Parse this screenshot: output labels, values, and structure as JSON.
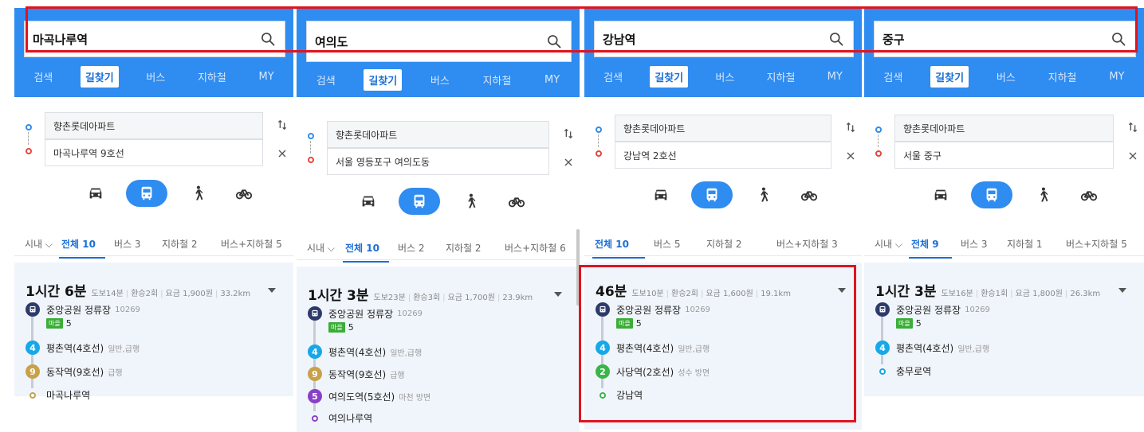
{
  "panels": [
    {
      "search": "마곡나루역",
      "nav": [
        "검색",
        "길찾기",
        "버스",
        "지하철",
        "MY"
      ],
      "active_nav": 1,
      "origin": "향촌롯데아파트",
      "destination": "마곡나루역 9호선",
      "tabs": [
        "시내 ⌵",
        "전체 10",
        "버스 3",
        "지하철 2",
        "버스+지하철 5"
      ],
      "active_tab": 1,
      "result": {
        "time": "1시간 6분",
        "walk": "도보14분",
        "transfer": "환승2회",
        "fare": "요금 1,900원",
        "distance": "33.2km",
        "steps": [
          {
            "badge": "bus",
            "color": "#2d3b6b",
            "name": "중앙공원 정류장",
            "sub": "10269"
          },
          {
            "badge": "4",
            "color": "#18a8e8",
            "name": "평촌역(4호선)",
            "sub": "일반,급행"
          },
          {
            "badge": "9",
            "color": "#c8a14a",
            "name": "동작역(9호선)",
            "sub": "급행"
          },
          {
            "badge": "end",
            "color": "#c8a14a",
            "name": "마곡나루역",
            "sub": ""
          }
        ],
        "bus_tag": "마을",
        "bus_no": "5"
      }
    },
    {
      "search": "여의도",
      "nav": [
        "검색",
        "길찾기",
        "버스",
        "지하철",
        "MY"
      ],
      "active_nav": 1,
      "origin": "향촌롯데아파트",
      "destination": "서울 영등포구 여의도동",
      "tabs": [
        "시내 ⌵",
        "전체 10",
        "버스 2",
        "지하철 2",
        "버스+지하철 6"
      ],
      "active_tab": 1,
      "result": {
        "time": "1시간 3분",
        "walk": "도보23분",
        "transfer": "환승3회",
        "fare": "요금 1,700원",
        "distance": "23.9km",
        "steps": [
          {
            "badge": "bus",
            "color": "#2d3b6b",
            "name": "중앙공원 정류장",
            "sub": "10269"
          },
          {
            "badge": "4",
            "color": "#18a8e8",
            "name": "평촌역(4호선)",
            "sub": "일반,급행"
          },
          {
            "badge": "9",
            "color": "#c8a14a",
            "name": "동작역(9호선)",
            "sub": "급행"
          },
          {
            "badge": "5",
            "color": "#8a3fc8",
            "name": "여의도역(5호선)",
            "sub": "마천 방면"
          },
          {
            "badge": "end",
            "color": "#8a3fc8",
            "name": "여의나루역",
            "sub": ""
          }
        ],
        "bus_tag": "마을",
        "bus_no": "5"
      }
    },
    {
      "search": "강남역",
      "nav": [
        "검색",
        "길찾기",
        "버스",
        "지하철",
        "MY"
      ],
      "active_nav": 1,
      "origin": "향촌롯데아파트",
      "destination": "강남역 2호선",
      "tabs": [
        "전체 10",
        "버스 5",
        "지하철 2",
        "버스+지하철 3"
      ],
      "active_tab": 0,
      "result": {
        "time": "46분",
        "walk": "도보10분",
        "transfer": "환승2회",
        "fare": "요금 1,600원",
        "distance": "19.1km",
        "steps": [
          {
            "badge": "bus",
            "color": "#2d3b6b",
            "name": "중앙공원 정류장",
            "sub": "10269"
          },
          {
            "badge": "4",
            "color": "#18a8e8",
            "name": "평촌역(4호선)",
            "sub": "일반,급행"
          },
          {
            "badge": "2",
            "color": "#3bb54a",
            "name": "사당역(2호선)",
            "sub": "성수 방면"
          },
          {
            "badge": "end",
            "color": "#3bb54a",
            "name": "강남역",
            "sub": ""
          }
        ],
        "bus_tag": "마을",
        "bus_no": "5"
      }
    },
    {
      "search": "중구",
      "nav": [
        "검색",
        "길찾기",
        "버스",
        "지하철",
        "MY"
      ],
      "active_nav": 1,
      "origin": "향촌롯데아파트",
      "destination": "서울 중구",
      "tabs": [
        "시내 ⌵",
        "전체 9",
        "버스 3",
        "지하철 1",
        "버스+지하철 5"
      ],
      "active_tab": 1,
      "result": {
        "time": "1시간 3분",
        "walk": "도보16분",
        "transfer": "환승1회",
        "fare": "요금 1,800원",
        "distance": "26.3km",
        "steps": [
          {
            "badge": "bus",
            "color": "#2d3b6b",
            "name": "중앙공원 정류장",
            "sub": "10269"
          },
          {
            "badge": "4",
            "color": "#18a8e8",
            "name": "평촌역(4호선)",
            "sub": "일반,급행"
          },
          {
            "badge": "end",
            "color": "#18a8e8",
            "name": "충무로역",
            "sub": ""
          }
        ],
        "bus_tag": "마을",
        "bus_no": "5"
      }
    }
  ],
  "colors": {
    "brand_blue": "#2f8cf0",
    "highlight_red": "#e0141e"
  },
  "icons": [
    "search-icon",
    "car-icon",
    "bus-icon",
    "walk-icon",
    "bike-icon",
    "swap-icon",
    "close-icon",
    "dropdown-caret-icon"
  ]
}
